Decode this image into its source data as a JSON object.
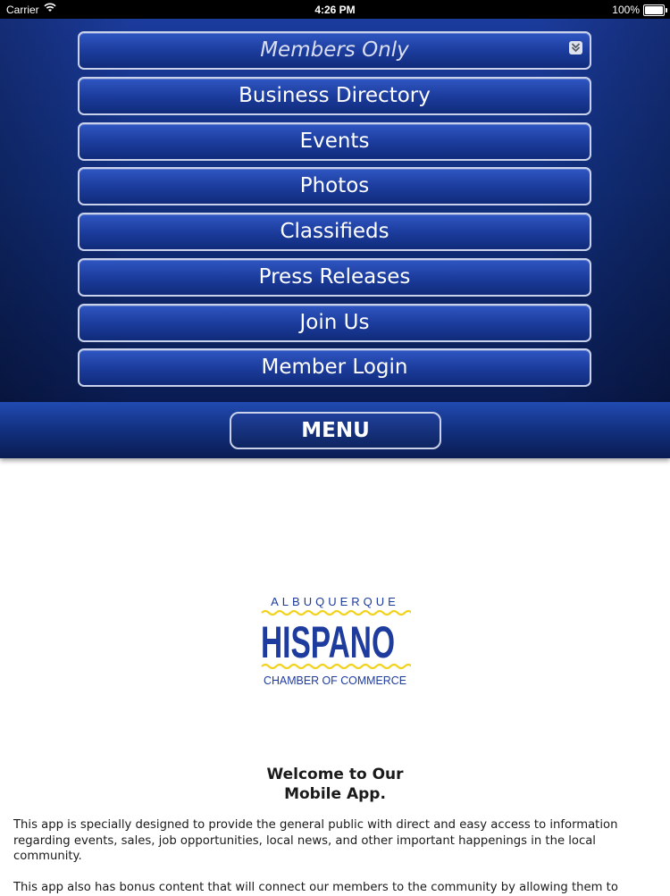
{
  "status_bar": {
    "carrier": "Carrier",
    "time": "4:26 PM",
    "battery": "100%"
  },
  "menu": {
    "items": [
      {
        "label": "Members Only",
        "icon": "chevron-down-icon"
      },
      {
        "label": "Business Directory"
      },
      {
        "label": "Events"
      },
      {
        "label": "Photos"
      },
      {
        "label": "Classifieds"
      },
      {
        "label": "Press Releases"
      },
      {
        "label": "Join Us"
      },
      {
        "label": "Member Login"
      }
    ],
    "toggle_label": "MENU"
  },
  "logo": {
    "top_text": "ALBUQUERQUE",
    "main_text": "HISPANO",
    "bottom_text": "CHAMBER OF COMMERCE"
  },
  "welcome": {
    "title_line1": "Welcome to Our",
    "title_line2": "Mobile App.",
    "paragraph1": "This app is specially designed to provide the general public with direct and easy access to information regarding events, sales, job opportunities, local news, and other important happenings in the local community.",
    "paragraph2": "This app also has bonus content that will connect our members to the community by allowing them to"
  },
  "colors": {
    "menu_background": "#12307f",
    "button_border": "#c9d2ea",
    "logo_blue": "#1e3b9e",
    "logo_yellow": "#f2d21b"
  }
}
